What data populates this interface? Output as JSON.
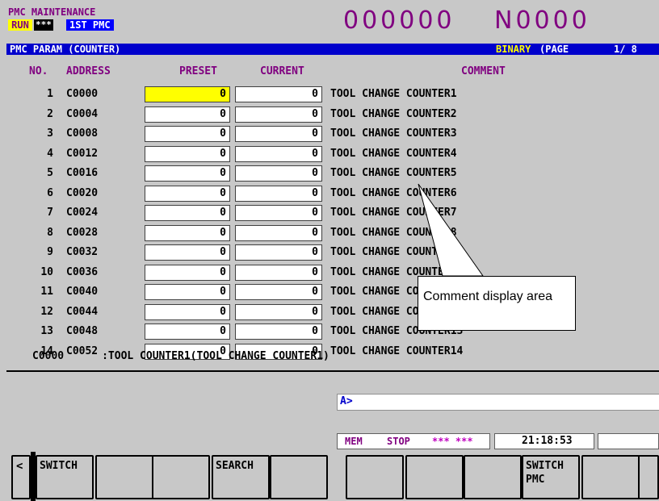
{
  "header": {
    "mode_title": "PMC MAINTENANCE",
    "run_label": "RUN",
    "stars": "***",
    "pmc_name": "1ST PMC",
    "program_o": "000000",
    "program_n": "N0000"
  },
  "title_bar": {
    "title": "PMC PARAM (COUNTER)",
    "format": "BINARY",
    "page_label": "(PAGE",
    "page_value": "1/  8"
  },
  "columns": {
    "no": "NO.",
    "address": "ADDRESS",
    "preset": "PRESET",
    "current": "CURRENT",
    "comment": "COMMENT"
  },
  "rows": [
    {
      "no": "1",
      "address": "C0000",
      "preset": "0",
      "current": "0",
      "comment": "TOOL CHANGE COUNTER1"
    },
    {
      "no": "2",
      "address": "C0004",
      "preset": "0",
      "current": "0",
      "comment": "TOOL CHANGE COUNTER2"
    },
    {
      "no": "3",
      "address": "C0008",
      "preset": "0",
      "current": "0",
      "comment": "TOOL CHANGE COUNTER3"
    },
    {
      "no": "4",
      "address": "C0012",
      "preset": "0",
      "current": "0",
      "comment": "TOOL CHANGE COUNTER4"
    },
    {
      "no": "5",
      "address": "C0016",
      "preset": "0",
      "current": "0",
      "comment": "TOOL CHANGE COUNTER5"
    },
    {
      "no": "6",
      "address": "C0020",
      "preset": "0",
      "current": "0",
      "comment": "TOOL CHANGE COUNTER6"
    },
    {
      "no": "7",
      "address": "C0024",
      "preset": "0",
      "current": "0",
      "comment": "TOOL CHANGE COUNTER7"
    },
    {
      "no": "8",
      "address": "C0028",
      "preset": "0",
      "current": "0",
      "comment": "TOOL CHANGE COUNTER8"
    },
    {
      "no": "9",
      "address": "C0032",
      "preset": "0",
      "current": "0",
      "comment": "TOOL CHANGE COUNTER9"
    },
    {
      "no": "10",
      "address": "C0036",
      "preset": "0",
      "current": "0",
      "comment": "TOOL CHANGE COUNTER10"
    },
    {
      "no": "11",
      "address": "C0040",
      "preset": "0",
      "current": "0",
      "comment": "TOOL CHANGE COUNTER11"
    },
    {
      "no": "12",
      "address": "C0044",
      "preset": "0",
      "current": "0",
      "comment": "TOOL CHANGE COUNTER12"
    },
    {
      "no": "13",
      "address": "C0048",
      "preset": "0",
      "current": "0",
      "comment": "TOOL CHANGE COUNTER13"
    },
    {
      "no": "14",
      "address": "C0052",
      "preset": "0",
      "current": "0",
      "comment": "TOOL CHANGE COUNTER14"
    }
  ],
  "selected_row": 0,
  "info_line": "C0000      :TOOL COUNTER1(TOOL CHANGE COUNTER1)",
  "input": {
    "prompt": "A>"
  },
  "status": {
    "mode": "MEM",
    "state": "STOP",
    "alarm": "*** ***",
    "time": "21:18:53"
  },
  "softkeys": [
    {
      "label": "SWITCH"
    },
    {
      "label": ""
    },
    {
      "label": ""
    },
    {
      "label": "SEARCH"
    },
    {
      "label": ""
    },
    {
      "label": ""
    },
    {
      "label": ""
    },
    {
      "label": ""
    },
    {
      "label": "SWITCH\nPMC"
    },
    {
      "label": ""
    },
    {
      "label": ""
    }
  ],
  "callout": {
    "text": "Comment display area"
  },
  "colors": {
    "title_bar": "#0000cc",
    "selected_cell": "#ffff00",
    "header_text": "#800080"
  }
}
